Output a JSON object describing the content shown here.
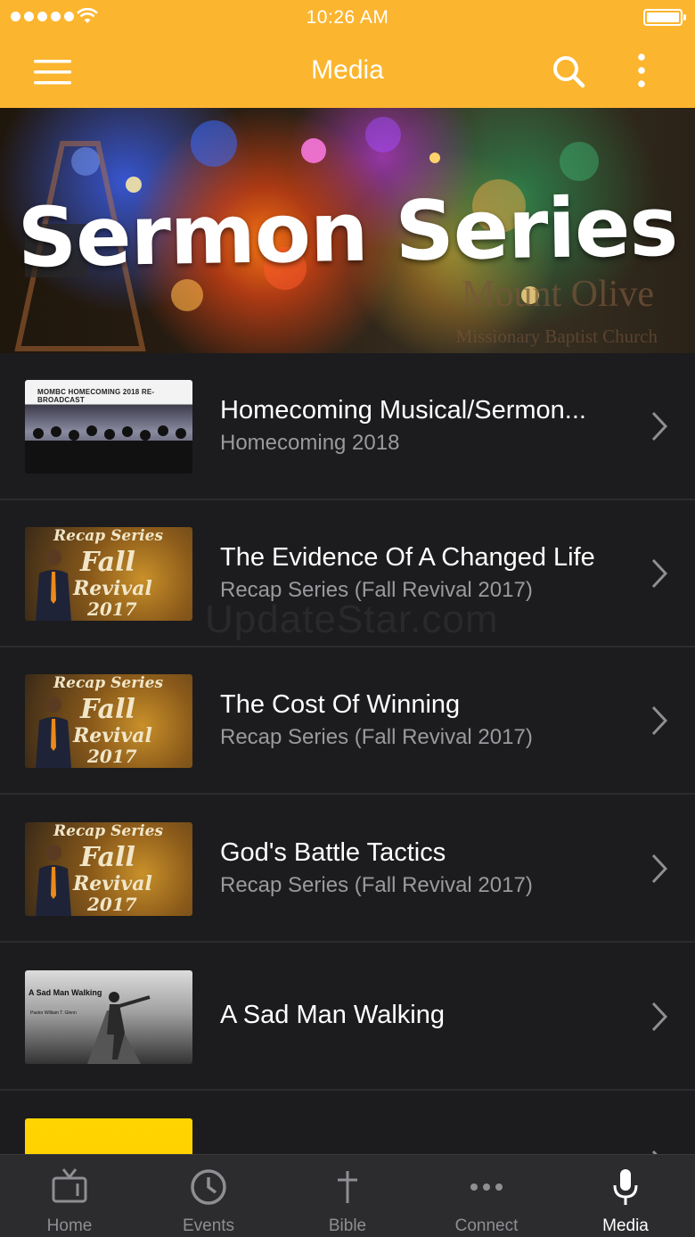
{
  "status_bar": {
    "time": "10:26 AM"
  },
  "nav": {
    "title": "Media",
    "menu_icon": "hamburger-icon",
    "search_icon": "search-icon",
    "more_icon": "more-vertical-icon"
  },
  "banner": {
    "title": "Sermon Series",
    "church_name": "Mount Olive",
    "church_subtitle": "Missionary Baptist Church"
  },
  "items": [
    {
      "title": "Homecoming Musical/Sermon...",
      "subtitle": "Homecoming 2018",
      "thumb_caption": "MOMBC HOMECOMING 2018 RE-BROADCAST"
    },
    {
      "title": "The Evidence Of A Changed Life",
      "subtitle": "Recap Series (Fall Revival 2017)",
      "thumb_caption": "Recap Series",
      "thumb_line2": "Fall",
      "thumb_line3": "Revival",
      "thumb_line4": "2017"
    },
    {
      "title": "The Cost Of Winning",
      "subtitle": "Recap Series (Fall Revival 2017)",
      "thumb_caption": "Recap Series",
      "thumb_line2": "Fall",
      "thumb_line3": "Revival",
      "thumb_line4": "2017"
    },
    {
      "title": "God's Battle Tactics",
      "subtitle": "Recap Series (Fall Revival 2017)",
      "thumb_caption": "Recap Series",
      "thumb_line2": "Fall",
      "thumb_line3": "Revival",
      "thumb_line4": "2017"
    },
    {
      "title": "A Sad Man Walking",
      "subtitle": "",
      "thumb_caption": "A Sad Man Walking",
      "thumb_caption2": "Pastor William T. Glenn"
    },
    {
      "title": "",
      "subtitle": ""
    }
  ],
  "watermark": "UpdateStar.com",
  "tabs": [
    {
      "label": "Home",
      "icon": "tv-icon"
    },
    {
      "label": "Events",
      "icon": "clock-icon"
    },
    {
      "label": "Bible",
      "icon": "cross-icon"
    },
    {
      "label": "Connect",
      "icon": "ellipsis-icon"
    },
    {
      "label": "Media",
      "icon": "microphone-icon",
      "active": true
    }
  ],
  "colors": {
    "accent": "#fbb52f",
    "background": "#1c1c1e",
    "tab_bar": "#2c2c2e",
    "subtitle": "#9a9a9e"
  }
}
